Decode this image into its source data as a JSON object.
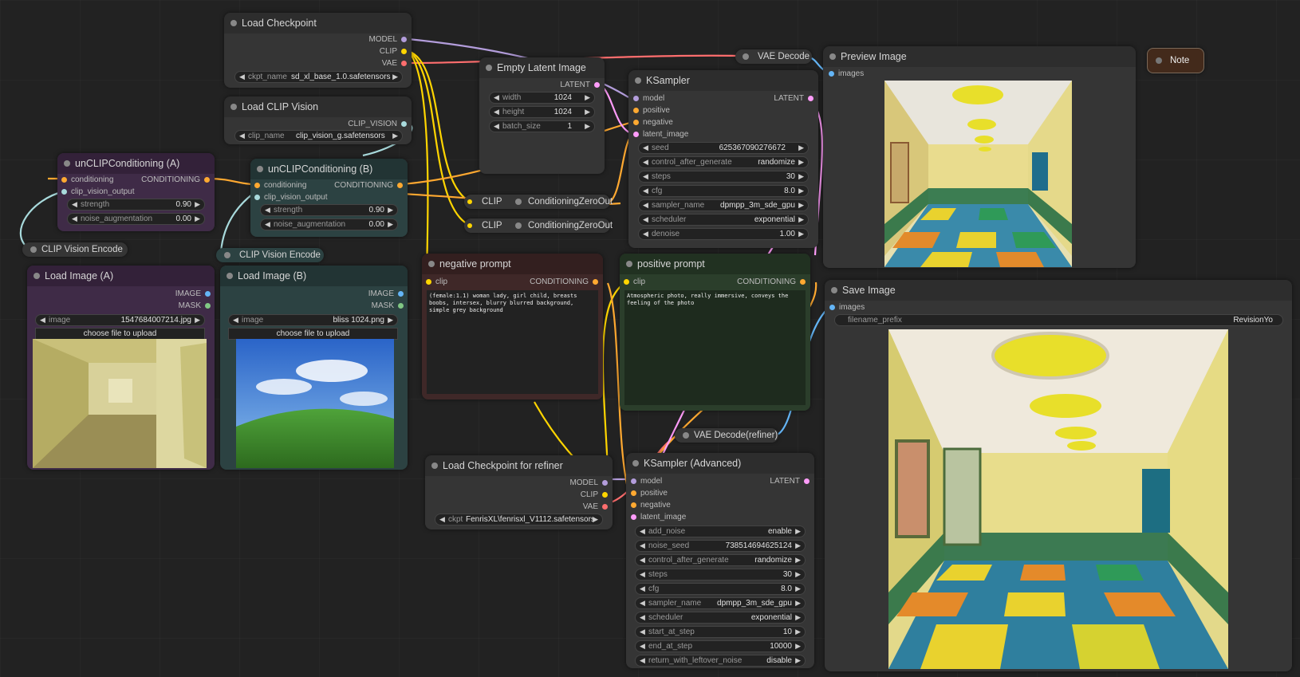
{
  "colors": {
    "model": "#b39ddb",
    "clip": "#ffd500",
    "vae": "#ff6e6e",
    "conditioning": "#ffa931",
    "latent": "#ff9cf9",
    "clip_vision": "#a8dadc",
    "image": "#64b5f6",
    "mask": "#81c784"
  },
  "nodes": {
    "load_checkpoint": {
      "title": "Load Checkpoint",
      "out_model": "MODEL",
      "out_clip": "CLIP",
      "out_vae": "VAE",
      "ckpt_label": "ckpt_name",
      "ckpt_value": "sd_xl_base_1.0.safetensors"
    },
    "load_clip_vision": {
      "title": "Load CLIP Vision",
      "out": "CLIP_VISION",
      "clip_label": "clip_name",
      "clip_value": "clip_vision_g.safetensors"
    },
    "empty_latent": {
      "title": "Empty Latent Image",
      "out": "LATENT",
      "width_label": "width",
      "width_value": "1024",
      "height_label": "height",
      "height_value": "1024",
      "batch_label": "batch_size",
      "batch_value": "1"
    },
    "vae_decode": {
      "title": "VAE Decode"
    },
    "preview_image": {
      "title": "Preview Image",
      "in_images": "images"
    },
    "note": {
      "title": "Note"
    },
    "ksampler": {
      "title": "KSampler",
      "in_model": "model",
      "in_positive": "positive",
      "in_negative": "negative",
      "in_latent": "latent_image",
      "out": "LATENT",
      "seed_label": "seed",
      "seed_value": "625367090276672",
      "cag_label": "control_after_generate",
      "cag_value": "randomize",
      "steps_label": "steps",
      "steps_value": "30",
      "cfg_label": "cfg",
      "cfg_value": "8.0",
      "sampler_label": "sampler_name",
      "sampler_value": "dpmpp_3m_sde_gpu",
      "scheduler_label": "scheduler",
      "scheduler_value": "exponential",
      "denoise_label": "denoise",
      "denoise_value": "1.00"
    },
    "unclip_a": {
      "title": "unCLIPConditioning (A)",
      "in_cond": "conditioning",
      "in_cvo": "clip_vision_output",
      "out": "CONDITIONING",
      "strength_label": "strength",
      "strength_value": "0.90",
      "noise_label": "noise_augmentation",
      "noise_value": "0.00"
    },
    "unclip_b": {
      "title": "unCLIPConditioning (B)",
      "in_cond": "conditioning",
      "in_cvo": "clip_vision_output",
      "out": "CONDITIONING",
      "strength_label": "strength",
      "strength_value": "0.90",
      "noise_label": "noise_augmentation",
      "noise_value": "0.00"
    },
    "cz1": {
      "clip": "CLIP",
      "title": "ConditioningZeroOut"
    },
    "cz2": {
      "clip": "CLIP",
      "title": "ConditioningZeroOut"
    },
    "clip_vision_encode_a": {
      "title": "CLIP Vision Encode"
    },
    "clip_vision_encode_b": {
      "title": "CLIP Vision Encode"
    },
    "load_image_a": {
      "title": "Load Image (A)",
      "out_image": "IMAGE",
      "out_mask": "MASK",
      "image_label": "image",
      "image_value": "1547684007214.jpg",
      "upload": "choose file to upload"
    },
    "load_image_b": {
      "title": "Load Image (B)",
      "out_image": "IMAGE",
      "out_mask": "MASK",
      "image_label": "image",
      "image_value": "bliss 1024.png",
      "upload": "choose file to upload"
    },
    "negative_prompt": {
      "title": "negative prompt",
      "in_clip": "clip",
      "out": "CONDITIONING",
      "text": "(female:1.1) woman lady, girl child, breasts boobs, intersex, blurry blurred background, simple grey background"
    },
    "positive_prompt": {
      "title": "positive prompt",
      "in_clip": "clip",
      "out": "CONDITIONING",
      "text": "Atmospheric photo, really immersive, conveys the feeling of the photo"
    },
    "save_image": {
      "title": "Save Image",
      "in_images": "images",
      "prefix_label": "filename_prefix",
      "prefix_value": "RevisionYo"
    },
    "vae_decode_refiner": {
      "title": "VAE Decode(refiner)"
    },
    "load_checkpoint_refiner": {
      "title": "Load Checkpoint for refiner",
      "out_model": "MODEL",
      "out_clip": "CLIP",
      "out_vae": "VAE",
      "ckpt_label": "ckpt",
      "ckpt_value": "FenrisXL\\fenrisxl_V1112.safetensors"
    },
    "ksampler_adv": {
      "title": "KSampler (Advanced)",
      "in_model": "model",
      "in_positive": "positive",
      "in_negative": "negative",
      "in_latent": "latent_image",
      "out": "LATENT",
      "add_noise_label": "add_noise",
      "add_noise_value": "enable",
      "noise_seed_label": "noise_seed",
      "noise_seed_value": "738514694625124",
      "cag_label": "control_after_generate",
      "cag_value": "randomize",
      "steps_label": "steps",
      "steps_value": "30",
      "cfg_label": "cfg",
      "cfg_value": "8.0",
      "sampler_label": "sampler_name",
      "sampler_value": "dpmpp_3m_sde_gpu",
      "scheduler_label": "scheduler",
      "scheduler_value": "exponential",
      "start_label": "start_at_step",
      "start_value": "10",
      "end_label": "end_at_step",
      "end_value": "10000",
      "rwl_label": "return_with_leftover_noise",
      "rwl_value": "disable"
    }
  }
}
